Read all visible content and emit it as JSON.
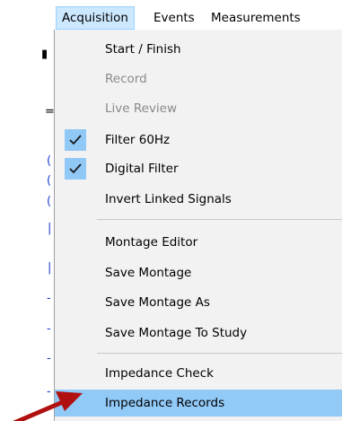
{
  "menubar": {
    "items": [
      "Acquisition",
      "Events",
      "Measurements"
    ]
  },
  "menu": {
    "items": [
      {
        "label": "Start / Finish",
        "disabled": false,
        "checked": false
      },
      {
        "label": "Record",
        "disabled": true,
        "checked": false
      },
      {
        "label": "Live Review",
        "disabled": true,
        "checked": false
      },
      {
        "label": "Filter 60Hz",
        "disabled": false,
        "checked": true
      },
      {
        "label": "Digital Filter",
        "disabled": false,
        "checked": true
      },
      {
        "label": "Invert Linked Signals",
        "disabled": false,
        "checked": false
      },
      {
        "label": "Montage Editor",
        "disabled": false,
        "checked": false
      },
      {
        "label": "Save Montage",
        "disabled": false,
        "checked": false
      },
      {
        "label": "Save Montage As",
        "disabled": false,
        "checked": false
      },
      {
        "label": "Save Montage To Study",
        "disabled": false,
        "checked": false
      },
      {
        "label": "Impedance Check",
        "disabled": false,
        "checked": false
      },
      {
        "label": "Impedance Records",
        "disabled": false,
        "checked": false,
        "highlighted": true
      }
    ]
  },
  "colors": {
    "highlight": "#91c9f7",
    "menu_bg": "#f2f2f2",
    "check_bg": "#90c8f6",
    "arrow": "#b01010"
  }
}
